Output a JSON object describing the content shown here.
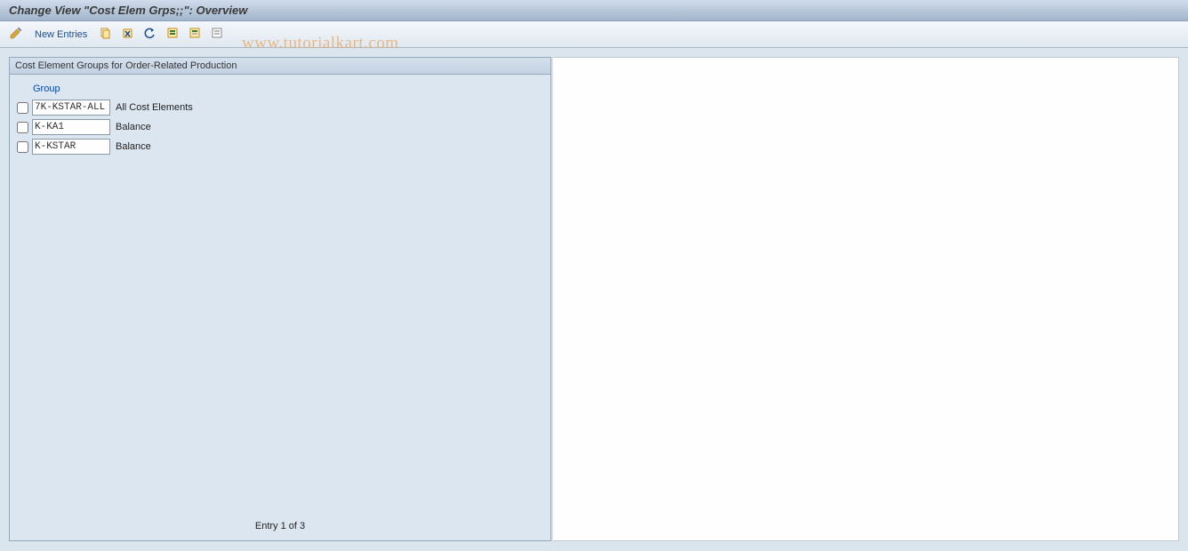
{
  "title": "Change View \"Cost Elem Grps;;\": Overview",
  "toolbar": {
    "new_entries_label": "New Entries",
    "icons": {
      "pencil": "pencil-icon",
      "copy": "copy-icon",
      "delete": "delete-icon",
      "undo": "undo-icon",
      "select_all": "select-all-icon",
      "select_block": "select-block-icon",
      "deselect_all": "deselect-all-icon"
    }
  },
  "panel": {
    "header": "Cost Element Groups for Order-Related Production",
    "column_header": "Group",
    "rows": [
      {
        "group": "7K-KSTAR-ALL",
        "desc": "All Cost Elements"
      },
      {
        "group": "K-KA1",
        "desc": "Balance"
      },
      {
        "group": "K-KSTAR",
        "desc": "Balance"
      }
    ],
    "footer": "Entry 1 of 3"
  },
  "watermark": "www.tutorialkart.com"
}
